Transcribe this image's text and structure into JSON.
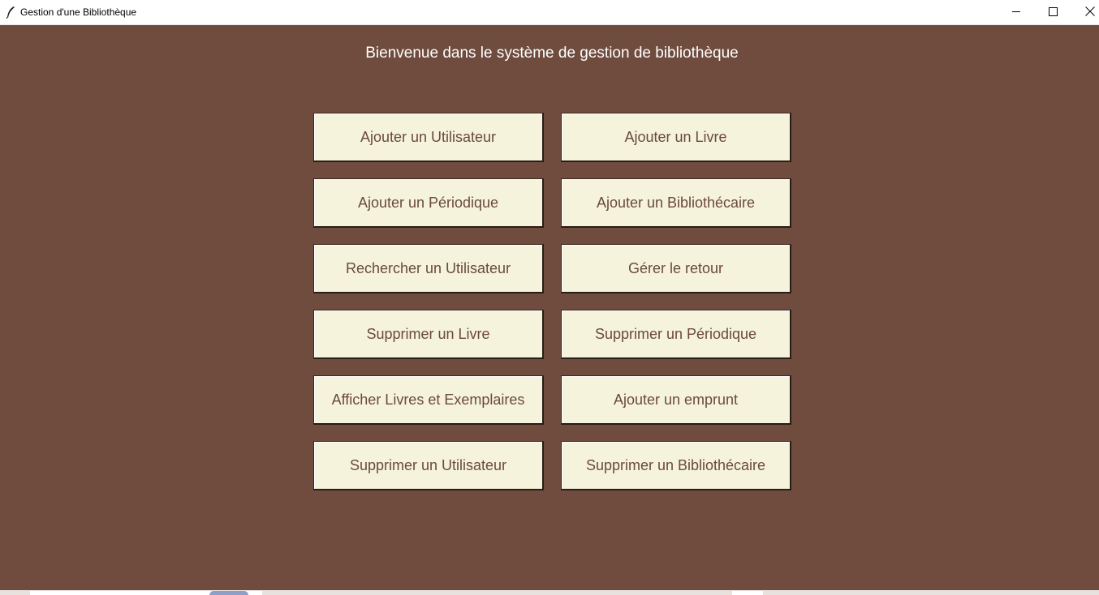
{
  "window": {
    "title": "Gestion d'une Bibliothèque",
    "icon": "feather-icon",
    "controls": {
      "minimize": "minimize-icon",
      "maximize": "maximize-icon",
      "close": "close-icon"
    }
  },
  "colors": {
    "background": "#6f4c3e",
    "button_bg": "#f5f3dc",
    "button_text": "#6b4a3a",
    "heading_text": "#ffffff"
  },
  "main": {
    "welcome": "Bienvenue dans le système de gestion de bibliothèque",
    "buttons": [
      {
        "label": "Ajouter un Utilisateur"
      },
      {
        "label": "Ajouter un Livre"
      },
      {
        "label": "Ajouter un Périodique"
      },
      {
        "label": "Ajouter un Bibliothécaire"
      },
      {
        "label": "Rechercher un Utilisateur"
      },
      {
        "label": "Gérer le retour"
      },
      {
        "label": "Supprimer un Livre"
      },
      {
        "label": "Supprimer un Périodique"
      },
      {
        "label": "Afficher Livres et Exemplaires"
      },
      {
        "label": "Ajouter un emprunt"
      },
      {
        "label": "Supprimer un Utilisateur"
      },
      {
        "label": "Supprimer un Bibliothécaire"
      }
    ]
  }
}
